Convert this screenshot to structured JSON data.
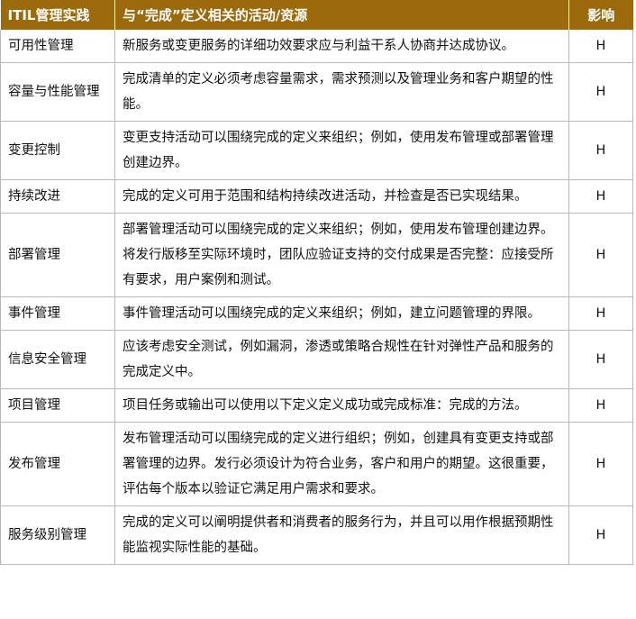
{
  "table": {
    "headers": {
      "practice": "ITIL管理实践",
      "activity": "与“完成”定义相关的活动/资源",
      "impact": "影响"
    },
    "rows": [
      {
        "practice": "可用性管理",
        "activity": "新服务或变更服务的详细功效要求应与利益干系人协商并达成协议。",
        "impact": "H",
        "height": 38
      },
      {
        "practice": "容量与性能管理",
        "activity": "完成清单的定义必须考虑容量需求，需求预测以及管理业务和客户期望的性能。",
        "impact": "H",
        "height": 71
      },
      {
        "practice": "变更控制",
        "activity": "变更支持活动可以围绕完成的定义来组织；例如，使用发布管理或部署管理创建边界。",
        "impact": "H",
        "height": 71
      },
      {
        "practice": "持续改进",
        "activity": "完成的定义可用于范围和结构持续改进活动，并检查是否已实现结果。",
        "impact": "H",
        "height": 38
      },
      {
        "practice": "部署管理",
        "activity": "部署管理活动可以围绕完成的定义来组织；例如，使用发布管理创建边界。将发行版移至实际环境时，团队应验证支持的交付成果是否完整：应接受所有要求，用户案例和测试。",
        "impact": "H",
        "height": 104
      },
      {
        "practice": "事件管理",
        "activity": "事件管理活动可以围绕完成的定义来组织；例如，建立问题管理的界限。",
        "impact": "H",
        "height": 38
      },
      {
        "practice": "信息安全管理",
        "activity": "应该考虑安全测试，例如漏洞，渗透或策略合规性在针对弹性产品和服务的完成定义中。",
        "impact": "H",
        "height": 71
      },
      {
        "practice": "项目管理",
        "activity": "项目任务或输出可以使用以下定义定义成功或完成标准：完成的方法。",
        "impact": "H",
        "height": 38
      },
      {
        "practice": "发布管理",
        "activity": "发布管理活动可以围绕完成的定义进行组织；例如，创建具有变更支持或部署管理的边界。发行必须设计为符合业务，客户和用户的期望。这很重要，评估每个版本以验证它满足用户需求和要求。",
        "impact": "H",
        "height": 104
      },
      {
        "practice": "服务级别管理",
        "activity": "完成的定义可以阐明提供者和消费者的服务行为，并且可以用作根据预期性能监视实际性能的基础。",
        "impact": "H",
        "height": 71
      }
    ]
  }
}
